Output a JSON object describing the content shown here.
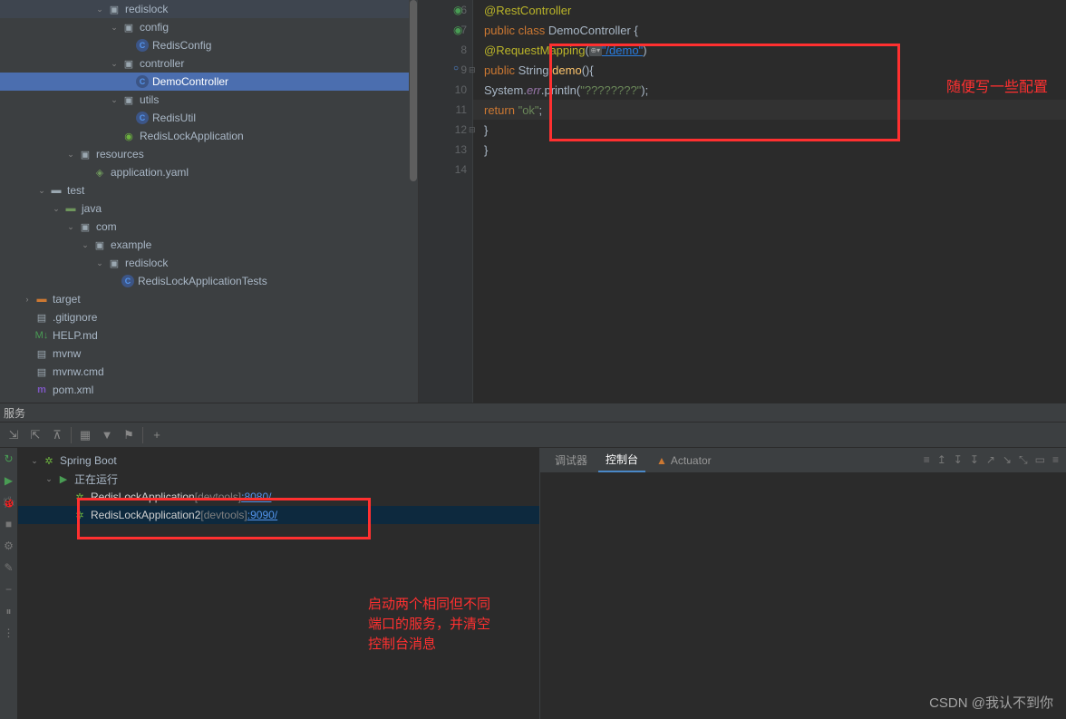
{
  "tree": {
    "redislock": "redislock",
    "config": "config",
    "redisConfig": "RedisConfig",
    "controller": "controller",
    "demoController": "DemoController",
    "utils": "utils",
    "redisUtil": "RedisUtil",
    "redisLockApp": "RedisLockApplication",
    "resources": "resources",
    "appYaml": "application.yaml",
    "test": "test",
    "java": "java",
    "com": "com",
    "example": "example",
    "redislock2": "redislock",
    "redisLockAppTests": "RedisLockApplicationTests",
    "target": "target",
    "gitignore": ".gitignore",
    "helpMd": "HELP.md",
    "mvnw": "mvnw",
    "mvnwCmd": "mvnw.cmd",
    "pomXml": "pom.xml"
  },
  "gutter": {
    "l6": "6",
    "l7": "7",
    "l8": "8",
    "l9": "9",
    "l10": "10",
    "l11": "11",
    "l12": "12",
    "l13": "13",
    "l14": "14"
  },
  "code": {
    "restController": "@RestController",
    "publicClass_kw1": "public class ",
    "publicClass_name": "DemoController",
    "publicClass_brace": " {",
    "reqMap_ann": "@RequestMapping",
    "reqMap_open": "(",
    "reqMap_path": "\"/demo\"",
    "reqMap_close": ")",
    "demo_kw": "public ",
    "demo_type": "String ",
    "demo_name": "demo",
    "demo_sig": "(){",
    "syserr_sys": "System.",
    "syserr_err": "err",
    "syserr_print": ".println(",
    "syserr_str": "\"????????\"",
    "syserr_close": ");",
    "return_kw": "return ",
    "return_val": "\"ok\"",
    "return_semi": ";",
    "brace1": "}",
    "brace2": "}"
  },
  "annotations": {
    "label1": "随便写一些配置",
    "label2_l1": "启动两个相同但不同",
    "label2_l2": "端口的服务，并清空",
    "label2_l3": "控制台消息"
  },
  "services": {
    "header": "服务",
    "springBoot": "Spring Boot",
    "running": "正在运行",
    "app1_name": "RedisLockApplication",
    "app1_tag": " [devtools] ",
    "app1_port": ":8080/",
    "app2_name": "RedisLockApplication2",
    "app2_tag": " [devtools] ",
    "app2_port": ":9090/",
    "tab_debug": "调试器",
    "tab_console": "控制台",
    "tab_actuator": "Actuator"
  },
  "watermark": "CSDN @我认不到你"
}
